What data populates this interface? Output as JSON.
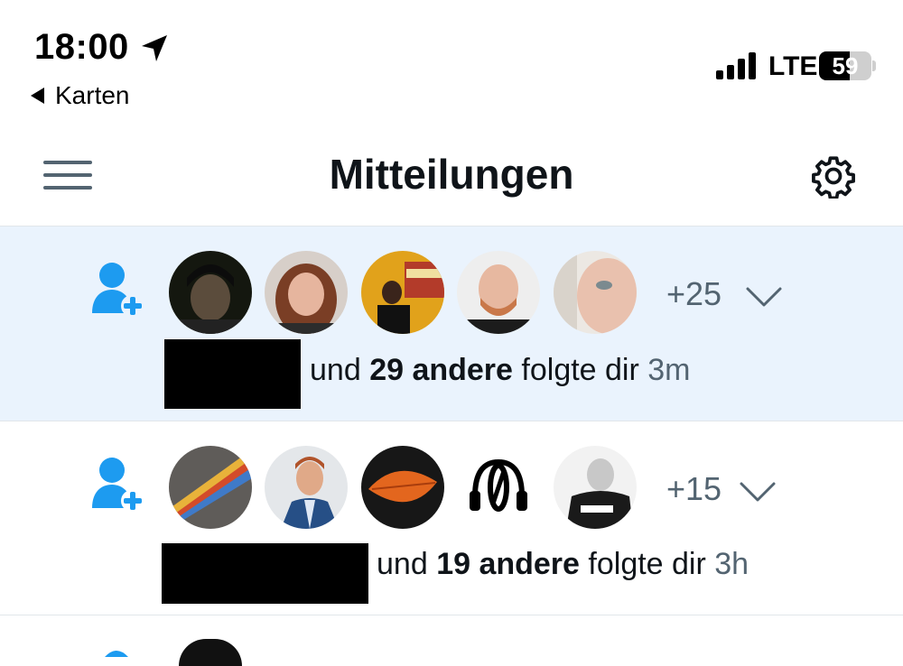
{
  "status_bar": {
    "time": "18:00",
    "back_label": "Karten",
    "network": "LTE",
    "battery": "59",
    "battery_level": 0.59
  },
  "header": {
    "title": "Mitteilungen",
    "menu_icon": "hamburger-menu-icon",
    "settings_icon": "gear-icon"
  },
  "notifications": [
    {
      "type": "follow",
      "icon": "user-plus-icon",
      "more_count": "+25",
      "text_prefix": "und",
      "count_text": "29 andere",
      "action": "folgte dir",
      "time_ago": "3m",
      "highlighted": true
    },
    {
      "type": "follow",
      "icon": "user-plus-icon",
      "more_count": "+15",
      "text_prefix": "und",
      "count_text": "19 andere",
      "action": "folgte dir",
      "time_ago": "3h",
      "highlighted": false
    }
  ],
  "colors": {
    "accent": "#1d9bf0",
    "unread_bg": "#eaf3fd",
    "muted_text": "#536471",
    "divider": "#e1e6ea"
  }
}
